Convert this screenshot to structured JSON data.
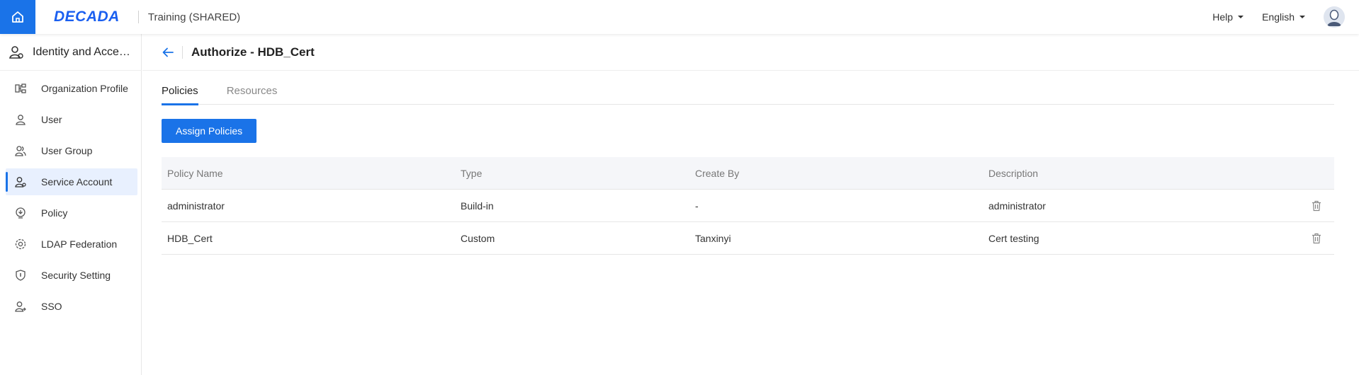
{
  "header": {
    "logo": "DECADA",
    "project": "Training (SHARED)",
    "help_label": "Help",
    "language_label": "English",
    "accent_color": "#1a73e8"
  },
  "sidebar": {
    "title": "Identity and Access Management",
    "items": [
      {
        "label": "Organization Profile",
        "icon": "org-chart-icon"
      },
      {
        "label": "User",
        "icon": "user-icon"
      },
      {
        "label": "User Group",
        "icon": "user-group-icon"
      },
      {
        "label": "Service Account",
        "icon": "service-account-icon",
        "active": true
      },
      {
        "label": "Policy",
        "icon": "policy-icon"
      },
      {
        "label": "LDAP Federation",
        "icon": "ldap-icon"
      },
      {
        "label": "Security Setting",
        "icon": "shield-icon"
      },
      {
        "label": "SSO",
        "icon": "sso-icon"
      }
    ]
  },
  "page": {
    "title": "Authorize - HDB_Cert",
    "tabs": [
      "Policies",
      "Resources"
    ],
    "active_tab": "Policies",
    "assign_button": "Assign Policies"
  },
  "table": {
    "columns": [
      "Policy Name",
      "Type",
      "Create By",
      "Description"
    ],
    "rows": [
      {
        "name": "administrator",
        "type": "Build-in",
        "created_by": "-",
        "description": "administrator"
      },
      {
        "name": "HDB_Cert",
        "type": "Custom",
        "created_by": "Tanxinyi",
        "description": "Cert testing"
      }
    ]
  }
}
